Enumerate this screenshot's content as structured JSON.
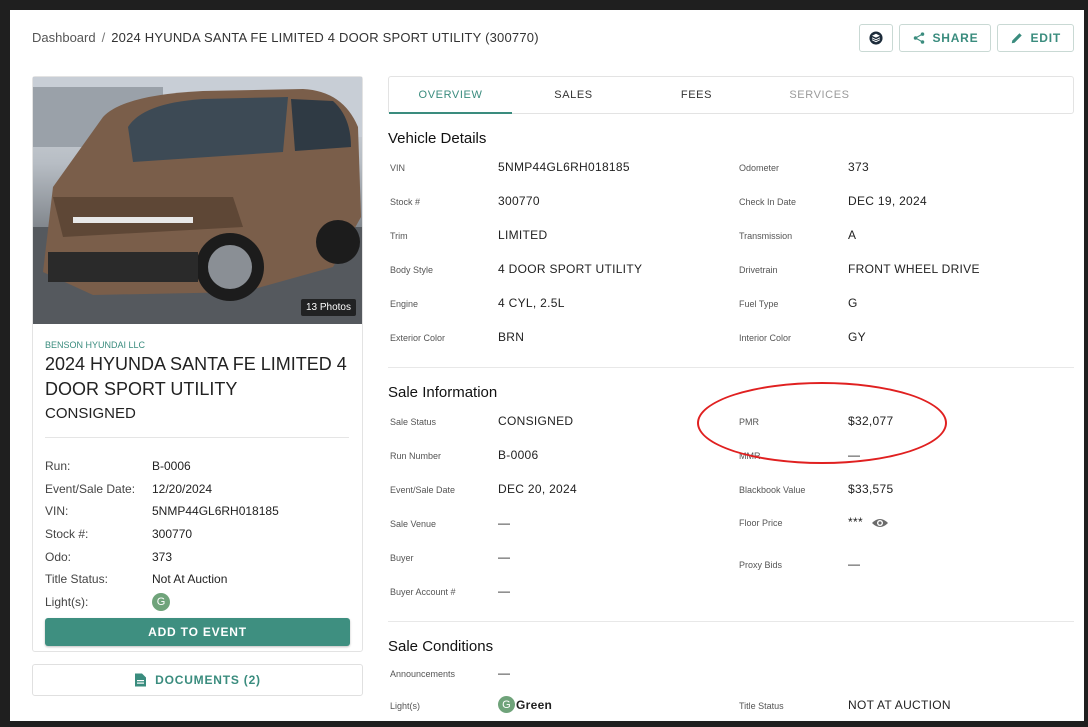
{
  "breadcrumb": {
    "root": "Dashboard",
    "separator": "/",
    "current": "2024 HYUNDA SANTA FE LIMITED 4 DOOR SPORT UTILITY (300770)"
  },
  "header_actions": {
    "share_label": "SHARE",
    "edit_label": "EDIT"
  },
  "vehicle_card": {
    "photo_count": "13 Photos",
    "dealer": "BENSON HYUNDAI LLC",
    "title": "2024 HYUNDA SANTA FE LIMITED 4 DOOR SPORT UTILITY",
    "status": "CONSIGNED",
    "fields": [
      {
        "label": "Run:",
        "value": "B-0006"
      },
      {
        "label": "Event/Sale Date:",
        "value": "12/20/2024"
      },
      {
        "label": "VIN:",
        "value": "5NMP44GL6RH018185"
      },
      {
        "label": "Stock #:",
        "value": "300770"
      },
      {
        "label": "Odo:",
        "value": "373"
      },
      {
        "label": "Title Status:",
        "value": "Not At Auction"
      },
      {
        "label": "Light(s):",
        "value": "G"
      }
    ],
    "add_button": "ADD TO EVENT",
    "documents_button": "DOCUMENTS (2)"
  },
  "tabs": [
    {
      "label": "OVERVIEW",
      "state": "active"
    },
    {
      "label": "SALES",
      "state": "normal"
    },
    {
      "label": "FEES",
      "state": "normal"
    },
    {
      "label": "SERVICES",
      "state": "disabled"
    }
  ],
  "vehicle_details": {
    "title": "Vehicle Details",
    "rows": [
      {
        "l1": "VIN",
        "v1": "5NMP44GL6RH018185",
        "l2": "Odometer",
        "v2": "373"
      },
      {
        "l1": "Stock #",
        "v1": "300770",
        "l2": "Check In Date",
        "v2": "DEC 19, 2024"
      },
      {
        "l1": "Trim",
        "v1": "LIMITED",
        "l2": "Transmission",
        "v2": "A"
      },
      {
        "l1": "Body Style",
        "v1": "4 DOOR SPORT UTILITY",
        "l2": "Drivetrain",
        "v2": "FRONT WHEEL DRIVE"
      },
      {
        "l1": "Engine",
        "v1": "4 CYL, 2.5L",
        "l2": "Fuel Type",
        "v2": "G"
      },
      {
        "l1": "Exterior Color",
        "v1": "BRN",
        "l2": "Interior Color",
        "v2": "GY"
      }
    ]
  },
  "sale_information": {
    "title": "Sale Information",
    "rows": [
      {
        "l1": "Sale Status",
        "v1": "CONSIGNED",
        "l2": "PMR",
        "v2": "$32,077"
      },
      {
        "l1": "Run Number",
        "v1": "B-0006",
        "l2": "MMR",
        "v2": "—"
      },
      {
        "l1": "Event/Sale Date",
        "v1": "DEC 20, 2024",
        "l2": "Blackbook Value",
        "v2": "$33,575"
      },
      {
        "l1": "Sale Venue",
        "v1": "—",
        "l2": "Floor Price",
        "v2": "***"
      },
      {
        "l1": "Buyer",
        "v1": "—",
        "l2": "Proxy Bids",
        "v2": "—"
      },
      {
        "l1": "Buyer Account #",
        "v1": "—",
        "l2": "",
        "v2": ""
      }
    ]
  },
  "sale_conditions": {
    "title": "Sale Conditions",
    "rows": [
      {
        "l1": "Announcements",
        "v1": "—",
        "l2": "",
        "v2": ""
      },
      {
        "l1": "Light(s)",
        "v1_badge": "G",
        "v1": "Green",
        "l2": "Title Status",
        "v2": "NOT AT AUCTION"
      }
    ]
  },
  "colors": {
    "accent": "#3a8c7e",
    "annotation": "#e02020",
    "light_green": "#6fa37a"
  }
}
